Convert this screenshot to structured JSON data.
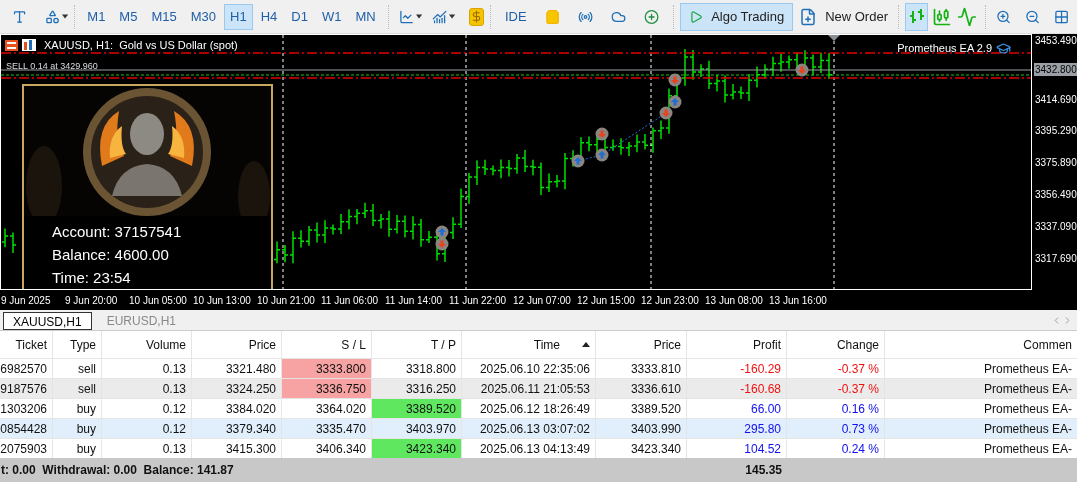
{
  "toolbar": {
    "timeframes": [
      {
        "label": "M1",
        "selected": false
      },
      {
        "label": "M5",
        "selected": false
      },
      {
        "label": "M15",
        "selected": false
      },
      {
        "label": "M30",
        "selected": false
      },
      {
        "label": "H1",
        "selected": true
      },
      {
        "label": "H4",
        "selected": false
      },
      {
        "label": "D1",
        "selected": false
      },
      {
        "label": "W1",
        "selected": false
      },
      {
        "label": "MN",
        "selected": false
      }
    ],
    "ide": "IDE",
    "algo_trading": {
      "label": "Algo Trading",
      "on": true
    },
    "new_order": "New Order",
    "chart_modes": [
      {
        "kind": "bars",
        "selected": true
      },
      {
        "kind": "candles",
        "selected": false
      },
      {
        "kind": "line",
        "selected": false
      }
    ]
  },
  "chart": {
    "title": "XAUUSD, H1:  Gold vs US Dollar (spot)",
    "order_line": "SELL 0.14 at 3429.960",
    "expert": "Prometheus EA 2.9",
    "info_panel": {
      "lines": [
        "Account: 37157541",
        "Balance: 4600.00",
        "Time: 23:54"
      ]
    },
    "price_axis": [
      {
        "label": "3453.490",
        "current": false
      },
      {
        "label": "3432.800",
        "current": true
      },
      {
        "label": "3414.690",
        "current": false
      },
      {
        "label": "3395.290",
        "current": false
      },
      {
        "label": "3375.890",
        "current": false
      },
      {
        "label": "3356.490",
        "current": false
      },
      {
        "label": "3337.090",
        "current": false
      },
      {
        "label": "3317.690",
        "current": false
      }
    ],
    "time_axis": [
      "9 Jun 2025",
      "9 Jun 20:00",
      "10 Jun 05:00",
      "10 Jun 13:00",
      "10 Jun 21:00",
      "11 Jun 06:00",
      "11 Jun 14:00",
      "11 Jun 22:00",
      "12 Jun 07:00",
      "12 Jun 15:00",
      "12 Jun 23:00",
      "13 Jun 08:00",
      "13 Jun 16:00"
    ]
  },
  "chart_tabs": [
    {
      "label": "XAUUSD,H1",
      "selected": true
    },
    {
      "label": "EURUSD,H1",
      "selected": false
    }
  ],
  "table": {
    "columns": [
      {
        "label": "Ticket",
        "sorted": false
      },
      {
        "label": "Type",
        "sorted": false
      },
      {
        "label": "Volume",
        "sorted": false
      },
      {
        "label": "Price",
        "sorted": false
      },
      {
        "label": "S / L",
        "sorted": false
      },
      {
        "label": "T / P",
        "sorted": false
      },
      {
        "label": "Time",
        "sorted": true
      },
      {
        "label": "Price",
        "sorted": false
      },
      {
        "label": "Profit",
        "sorted": false
      },
      {
        "label": "Change",
        "sorted": false
      },
      {
        "label": "Commen",
        "sorted": false
      }
    ],
    "rows": [
      {
        "cells": [
          "6982570",
          "sell",
          "0.13",
          "3321.480",
          "3333.800",
          "3318.800",
          "2025.06.10 22:35:06",
          "3333.810",
          "-160.29",
          "-0.37 %",
          "Prometheus EA-"
        ],
        "selected": false,
        "hovered": false,
        "sl_near": true,
        "tp_near": false,
        "loss": true
      },
      {
        "cells": [
          "9187576",
          "sell",
          "0.13",
          "3324.250",
          "3336.750",
          "3316.250",
          "2025.06.11 21:05:53",
          "3336.610",
          "-160.68",
          "-0.37 %",
          "Prometheus EA-"
        ],
        "selected": false,
        "hovered": true,
        "sl_near": true,
        "tp_near": false,
        "loss": true
      },
      {
        "cells": [
          "1303206",
          "buy",
          "0.12",
          "3384.020",
          "3364.020",
          "3389.520",
          "2025.06.12 18:26:49",
          "3389.520",
          "66.00",
          "0.16 %",
          "Prometheus EA-"
        ],
        "selected": false,
        "hovered": false,
        "sl_near": false,
        "tp_near": true,
        "loss": false
      },
      {
        "cells": [
          "0854428",
          "buy",
          "0.12",
          "3379.340",
          "3335.470",
          "3403.970",
          "2025.06.13 03:07:02",
          "3403.990",
          "295.80",
          "0.73 %",
          "Prometheus EA-"
        ],
        "selected": true,
        "hovered": false,
        "sl_near": false,
        "tp_near": false,
        "loss": false
      },
      {
        "cells": [
          "2075903",
          "buy",
          "0.13",
          "3415.300",
          "3406.340",
          "3423.340",
          "2025.06.13 04:13:49",
          "3423.340",
          "104.52",
          "0.24 %",
          "Prometheus EA-"
        ],
        "selected": false,
        "hovered": false,
        "sl_near": false,
        "tp_near": true,
        "loss": false
      }
    ],
    "footer": {
      "summary": "t: 0.00  Withdrawal: 0.00  Balance: 141.87",
      "total_profit": "145.35"
    }
  }
}
